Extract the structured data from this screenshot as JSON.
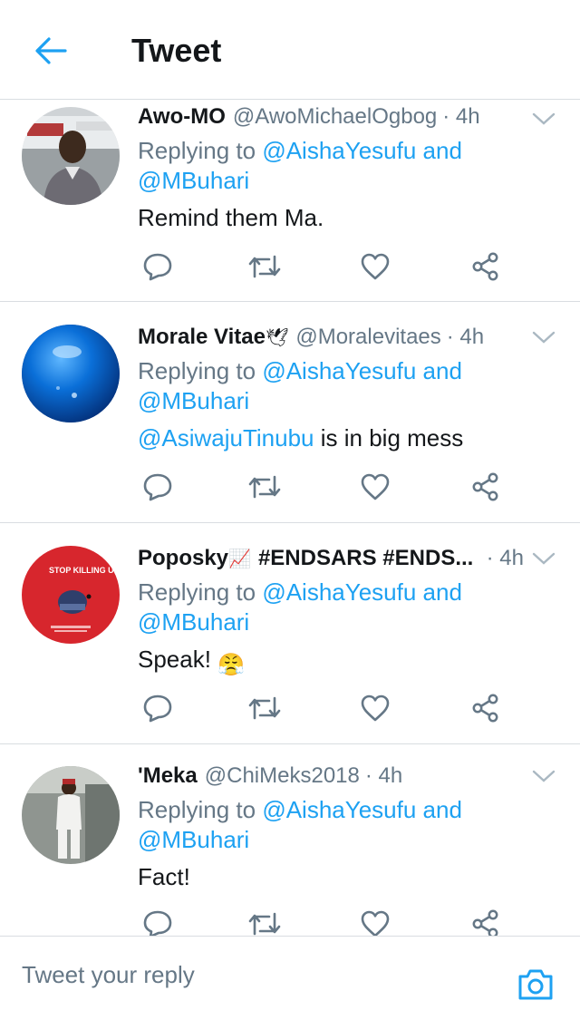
{
  "header": {
    "title": "Tweet",
    "back_icon": "arrow-left-icon",
    "accent": "#1da1f2"
  },
  "tweets": [
    {
      "name": "Awo-MO",
      "handle": "@AwoMichaelOgbog",
      "time": "· 4h",
      "reply_prefix": "Replying to",
      "reply_user1": "@AishaYesufu",
      "reply_and": "and",
      "reply_user2": "@MBuhari",
      "text": "Remind them Ma.",
      "avatar": "man-photo-avatar"
    },
    {
      "name": "Morale Vitae",
      "name_emoji": "🕊",
      "handle": "@Moralevitaes",
      "time": "· 4h",
      "reply_prefix": "Replying to",
      "reply_user1": "@AishaYesufu",
      "reply_and": "and",
      "reply_user2": "@MBuhari",
      "text_mention": "@AsiwajuTinubu",
      "text": "is in big mess",
      "avatar": "blue-sphere-avatar"
    },
    {
      "name": "Poposky",
      "name_emoji": "📈",
      "name_rest": "#ENDSARS #ENDS...",
      "time": "· 4h",
      "reply_prefix": "Replying to",
      "reply_user1": "@AishaYesufu",
      "reply_and": "and",
      "reply_user2": "@MBuhari",
      "text": "Speak!",
      "text_emoji": "😤",
      "avatar": "stop-killing-us-avatar",
      "avatar_text": "STOP KILLING US"
    },
    {
      "name": "'Meka",
      "handle": "@ChiMeks2018",
      "time": "· 4h",
      "reply_prefix": "Replying to",
      "reply_user1": "@AishaYesufu",
      "reply_and": "and",
      "reply_user2": "@MBuhari",
      "text": "Fact!",
      "avatar": "man-white-outfit-avatar"
    }
  ],
  "composer": {
    "placeholder": "Tweet your reply",
    "camera_icon": "camera-icon"
  }
}
